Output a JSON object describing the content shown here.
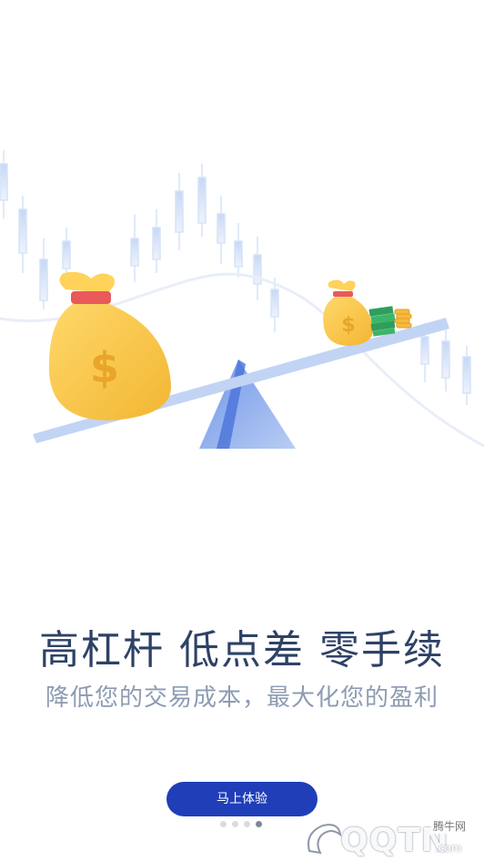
{
  "headline": "高杠杆 低点差 零手续",
  "subtitle": "降低您的交易成本，最大化您的盈利",
  "cta_label": "马上体验",
  "pager": {
    "count": 4,
    "active_index": 3
  },
  "watermark": {
    "logo_text": "QQTN",
    "cn_text": "腾牛网",
    "suffix": ".com"
  },
  "illustration": {
    "big_bag_symbol": "$",
    "small_bag_symbol": "$"
  },
  "colors": {
    "brand_blue": "#1f3eb8",
    "headline": "#2e4266",
    "subtitle": "#8d9bb3",
    "gold": "#f6c445",
    "candle": "#c9daf6"
  },
  "icons": [
    "money-bag-icon",
    "cash-stack-icon",
    "coin-stack-icon",
    "seesaw-icon"
  ]
}
